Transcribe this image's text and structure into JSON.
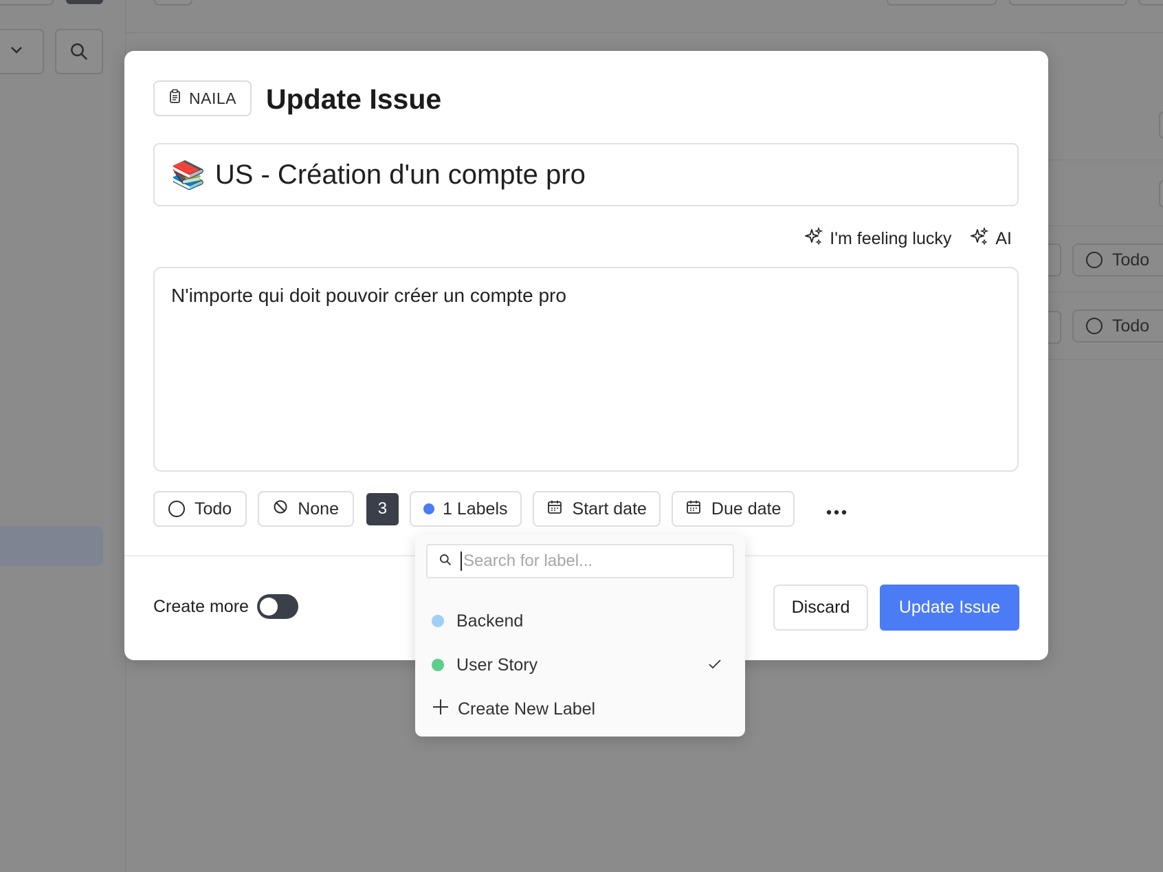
{
  "background": {
    "status_pill_1": "Todo",
    "status_pill_2": "Todo"
  },
  "modal": {
    "project_badge": "NAILA",
    "title": "Update Issue",
    "issue_title_emoji": "📚",
    "issue_title": "US - Création d'un compte pro",
    "feeling_lucky_label": "I'm feeling lucky",
    "ai_label": "AI",
    "description": "N'importe qui doit pouvoir créer un compte pro",
    "properties": {
      "status": "Todo",
      "priority": "None",
      "estimate": "3",
      "labels": "1 Labels",
      "start_date": "Start date",
      "due_date": "Due date"
    },
    "create_more_label": "Create more",
    "create_more_enabled": false,
    "discard_label": "Discard",
    "submit_label": "Update Issue"
  },
  "label_dropdown": {
    "search_placeholder": "Search for label...",
    "items": [
      {
        "name": "Backend",
        "color": "#9fd0f5",
        "selected": false
      },
      {
        "name": "User Story",
        "color": "#5ccf8a",
        "selected": true
      }
    ],
    "create_label": "Create New Label"
  },
  "colors": {
    "accent": "#4b7bf5",
    "label_dot": "#4b7bf5",
    "estimate_bg": "#3a3f4a"
  }
}
